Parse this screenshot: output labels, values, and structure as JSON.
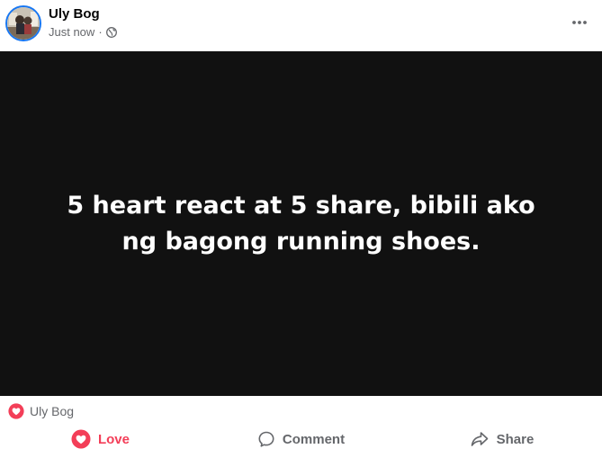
{
  "post": {
    "author": "Uly Bog",
    "timestamp": "Just now",
    "separator": "·",
    "privacy_icon": "globe-icon",
    "menu_icon": "more-options-icon",
    "content_text": "5 heart react at 5 share, bibili ako ng bagong running shoes.",
    "background_color": "#111111",
    "text_color": "#ffffff"
  },
  "reactions": {
    "icon": "love-reaction-icon",
    "summary": "Uly Bog"
  },
  "actions": {
    "love_label": "Love",
    "comment_label": "Comment",
    "share_label": "Share"
  },
  "colors": {
    "love": "#f33e58",
    "accent": "#1877f2",
    "secondary_text": "#65676b"
  }
}
